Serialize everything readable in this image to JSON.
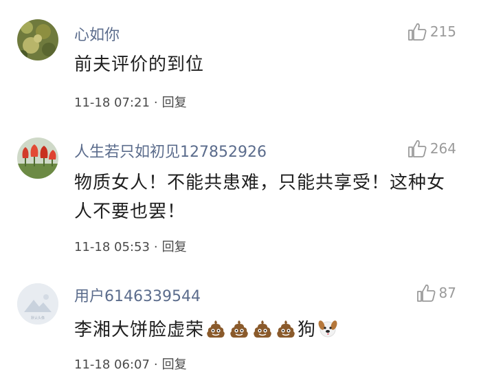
{
  "comments": [
    {
      "username": "心如你",
      "content": "前夫评价的到位",
      "time": "11-18 07:21",
      "reply_label": "回复",
      "likes": "215"
    },
    {
      "username": "人生若只如初见127852926",
      "content": "物质女人！不能共患难，只能共享受！这种女人不要也罢！",
      "time": "11-18 05:53",
      "reply_label": "回复",
      "likes": "264"
    },
    {
      "username": "用户6146339544",
      "content_text": "李湘大饼脸虚荣",
      "content_suffix": "狗",
      "emoji_icons": [
        "poop-icon",
        "poop-icon",
        "poop-icon",
        "poop-icon",
        "dog-face-icon"
      ],
      "time": "11-18 06:07",
      "reply_label": "回复",
      "likes": "87",
      "avatar_caption": "默认头像"
    }
  ]
}
